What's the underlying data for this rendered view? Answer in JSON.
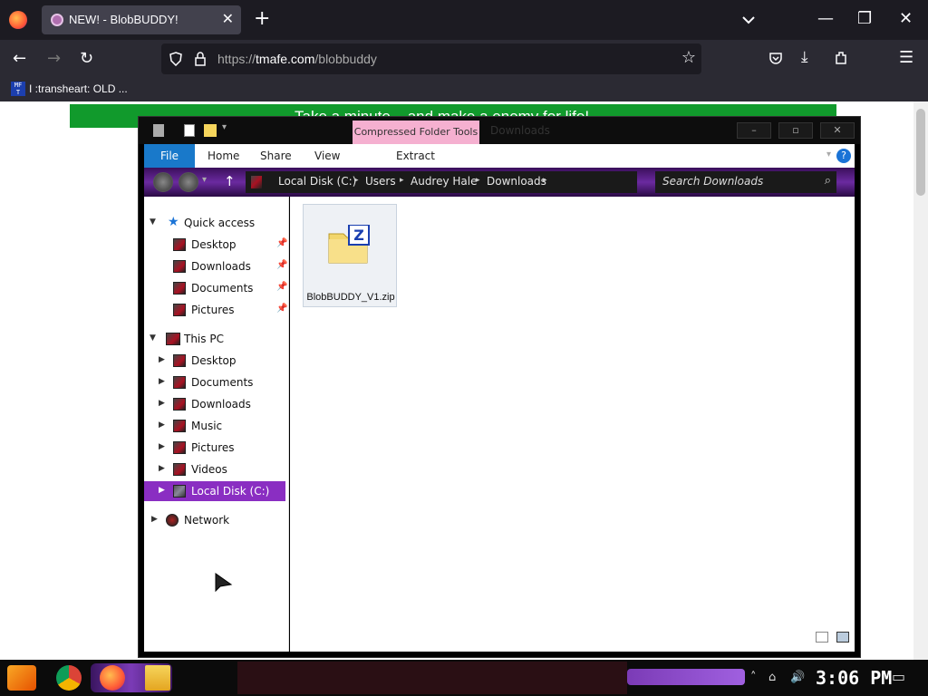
{
  "browser": {
    "tab_title": "NEW! - BlobBUDDY!",
    "tab_close": "✕",
    "new_tab": "+",
    "url_prefix": "https://",
    "url_host": "tmafe.com",
    "url_path": "/blobbuddy",
    "bookmark_label": "I :transheart: OLD ...",
    "bookmark_icon_text": "MF T",
    "window_controls": [
      "—",
      "❐",
      "✕"
    ]
  },
  "page": {
    "banner_text": "Take a minute... and make a enemy for life!"
  },
  "explorer": {
    "contextual_tab": "Compressed Folder Tools",
    "title": "Downloads",
    "title_buttons": [
      "–",
      "▫",
      "✕"
    ],
    "ribbon": {
      "file": "File",
      "tabs": [
        "Home",
        "Share",
        "View"
      ],
      "extract": "Extract",
      "help": "?"
    },
    "breadcrumb": [
      "Local Disk (C:)",
      "Users",
      "Audrey Hale",
      "Downloads"
    ],
    "search_placeholder": "Search Downloads",
    "nav": {
      "quick_access": "Quick access",
      "quick_items": [
        "Desktop",
        "Downloads",
        "Documents",
        "Pictures"
      ],
      "this_pc": "This PC",
      "pc_items": [
        "Desktop",
        "Documents",
        "Downloads",
        "Music",
        "Pictures",
        "Videos"
      ],
      "local_disk": "Local Disk (C:)",
      "network": "Network"
    },
    "files": [
      {
        "name": "BlobBUDDY_V1.zip",
        "icon": "zip-folder-icon"
      }
    ]
  },
  "taskbar": {
    "clock": "3:06 PM",
    "apps": [
      "chrome-icon",
      "firefox-icon",
      "file-explorer-icon"
    ]
  },
  "colors": {
    "accent_purple": "#8a2ec2",
    "ribbon_file_blue": "#1979ca",
    "banner_green": "#119a2c",
    "context_pink": "#f5b0d0"
  }
}
